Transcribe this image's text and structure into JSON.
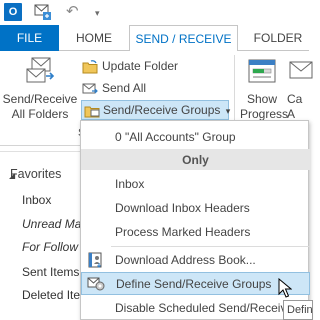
{
  "qat": {
    "app_icon_letter": "O",
    "undo_glyph": "↶",
    "more_glyph": "▾"
  },
  "tabs": {
    "file": "FILE",
    "home": "HOME",
    "send_receive": "SEND / RECEIVE",
    "folder": "FOLDER"
  },
  "ribbon": {
    "send_receive_all_line1": "Send/Receive",
    "send_receive_all_line2": "All Folders",
    "update_folder": "Update Folder",
    "send_all": "Send All",
    "send_receive_groups": "Send/Receive Groups",
    "groups_arrow": "▾",
    "show_progress_line1": "Show",
    "show_progress_line2": "Progress",
    "cancel_all_line1": "Ca",
    "cancel_all_line2": "A",
    "group_label_fragment": "S"
  },
  "pane": {
    "favorites": "Favorites",
    "items": [
      "Inbox",
      "Unread Ma",
      "For Follow U",
      "Sent Items",
      "Deleted Item"
    ]
  },
  "menu": {
    "all_accounts": "0 \"All Accounts\" Group",
    "only": "Only",
    "inbox": "Inbox",
    "download_inbox_headers": "Download Inbox Headers",
    "process_marked_headers": "Process Marked Headers",
    "download_address_book": "Download Address Book...",
    "define_groups": "Define Send/Receive Groups",
    "disable_scheduled": "Disable Scheduled Send/Receive"
  },
  "tooltip": "Defin",
  "colors": {
    "accent": "#0072c6",
    "highlight": "#cde6f7",
    "highlight_border": "#92c0e0"
  }
}
